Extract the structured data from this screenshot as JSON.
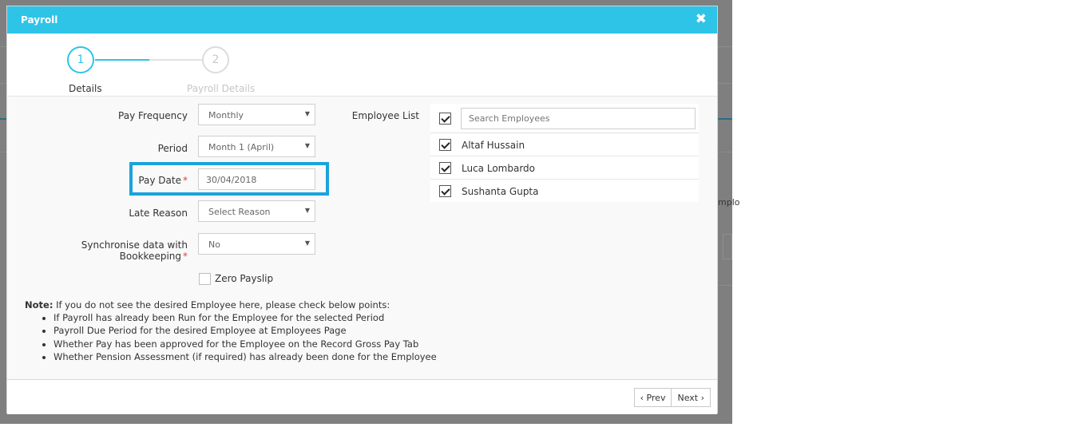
{
  "background": {
    "partial_text": "mplo"
  },
  "modal": {
    "title": "Payroll",
    "close_icon": "close-icon",
    "steps": [
      {
        "number": "1",
        "label": "Details",
        "active": true
      },
      {
        "number": "2",
        "label": "Payroll Details",
        "active": false
      }
    ]
  },
  "form": {
    "pay_frequency": {
      "label": "Pay Frequency",
      "value": "Monthly"
    },
    "period": {
      "label": "Period",
      "value": "Month 1 (April)"
    },
    "pay_date": {
      "label": "Pay Date",
      "required": "*",
      "value": "30/04/2018"
    },
    "late_reason": {
      "label": "Late Reason",
      "value": "Select Reason"
    },
    "sync": {
      "label": "Synchronise data with Bookkeeping",
      "required": "*",
      "value": "No"
    },
    "zero_payslip": {
      "label": "Zero Payslip",
      "checked": false
    }
  },
  "employees": {
    "label": "Employee List",
    "search_placeholder": "Search Employees",
    "select_all_checked": true,
    "list": [
      {
        "name": "Altaf Hussain",
        "checked": true
      },
      {
        "name": "Luca Lombardo",
        "checked": true
      },
      {
        "name": "Sushanta Gupta",
        "checked": true
      }
    ]
  },
  "note": {
    "prefix": "Note:",
    "text": " If you do not see the desired Employee here, please check below points:",
    "points": [
      "If Payroll has already been Run for the Employee for the selected Period",
      "Payroll Due Period for the desired Employee at Employees Page",
      "Whether Pay has been approved for the Employee on the Record Gross Pay Tab",
      "Whether Pension Assessment (if required) has already been done for the Employee"
    ]
  },
  "footer": {
    "prev_label": "‹ Prev",
    "next_label": "Next ›"
  },
  "colors": {
    "accent": "#2ec4e8",
    "highlight": "#1aa3dc"
  }
}
